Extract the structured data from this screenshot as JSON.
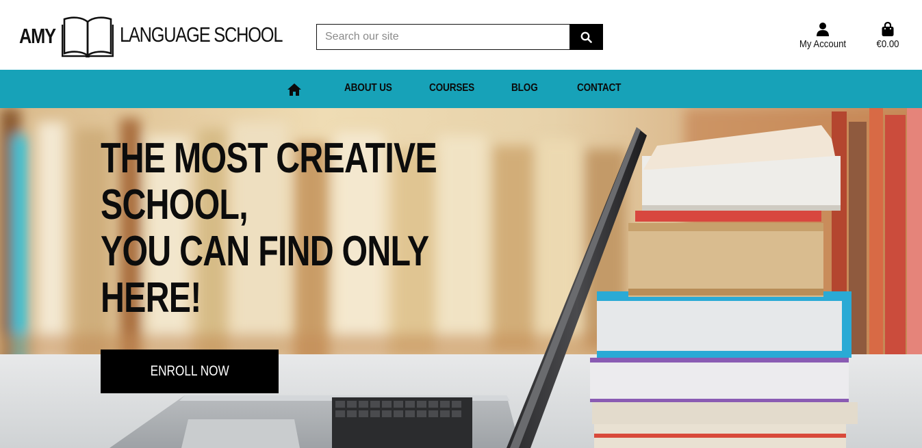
{
  "brand": {
    "name_left": "AMY",
    "name_right": "LANGUAGE SCHOOL",
    "logo_icon": "open-book-icon"
  },
  "search": {
    "placeholder": "Search our site",
    "value": "",
    "button_icon": "search-icon"
  },
  "header_actions": {
    "account_label": "My Account",
    "account_icon": "user-icon",
    "cart_label": "€0.00",
    "cart_icon": "shopping-bag-icon"
  },
  "nav": {
    "home_icon": "home-icon",
    "items": [
      {
        "label": "ABOUT US"
      },
      {
        "label": "COURSES"
      },
      {
        "label": "BLOG"
      },
      {
        "label": "CONTACT"
      }
    ]
  },
  "hero": {
    "title_lines": [
      "THE MOST CREATIVE",
      "SCHOOL,",
      "YOU CAN FIND ONLY",
      "HERE!"
    ],
    "cta_label": "ENROLL NOW",
    "background": "library-laptop-books-photo"
  },
  "colors": {
    "accent": "#17a2b8",
    "text": "#111111",
    "button": "#000000"
  }
}
